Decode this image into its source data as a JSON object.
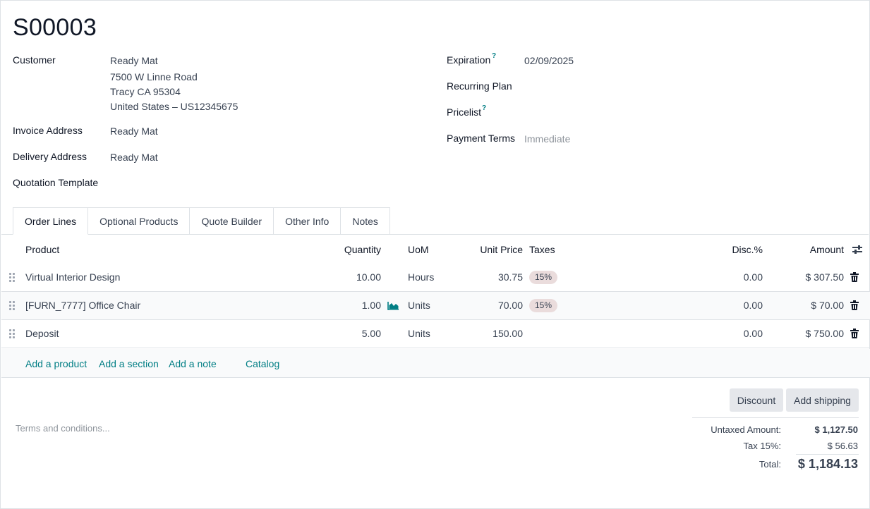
{
  "record": {
    "title": "S00003"
  },
  "left_fields": {
    "customer_label": "Customer",
    "customer_name": "Ready Mat",
    "customer_addr1": "7500 W Linne Road",
    "customer_addr2": "Tracy CA 95304",
    "customer_addr3": "United States – US12345675",
    "invoice_label": "Invoice Address",
    "invoice_value": "Ready Mat",
    "delivery_label": "Delivery Address",
    "delivery_value": "Ready Mat",
    "template_label": "Quotation Template"
  },
  "right_fields": {
    "expiration_label": "Expiration",
    "expiration_help": "?",
    "expiration_value": "02/09/2025",
    "recurring_label": "Recurring Plan",
    "pricelist_label": "Pricelist",
    "pricelist_help": "?",
    "payment_label": "Payment Terms",
    "payment_placeholder": "Immediate"
  },
  "tabs": [
    {
      "label": "Order Lines",
      "active": true
    },
    {
      "label": "Optional Products"
    },
    {
      "label": "Quote Builder"
    },
    {
      "label": "Other Info"
    },
    {
      "label": "Notes"
    }
  ],
  "columns": {
    "product": "Product",
    "quantity": "Quantity",
    "uom": "UoM",
    "unit_price": "Unit Price",
    "taxes": "Taxes",
    "discount": "Disc.%",
    "amount": "Amount"
  },
  "lines": [
    {
      "product": "Virtual Interior Design",
      "quantity": "10.00",
      "uom": "Hours",
      "unit_price": "30.75",
      "tax": "15%",
      "discount": "0.00",
      "amount": "$ 307.50"
    },
    {
      "product": "[FURN_7777] Office Chair",
      "quantity": "1.00",
      "uom": "Units",
      "unit_price": "70.00",
      "tax": "15%",
      "discount": "0.00",
      "amount": "$ 70.00"
    },
    {
      "product": "Deposit",
      "quantity": "5.00",
      "uom": "Units",
      "unit_price": "150.00",
      "tax": "",
      "discount": "0.00",
      "amount": "$ 750.00"
    }
  ],
  "add_links": {
    "add_product": "Add a product",
    "add_section": "Add a section",
    "add_note": "Add a note",
    "catalog": "Catalog"
  },
  "buttons": {
    "discount": "Discount",
    "add_shipping": "Add shipping"
  },
  "terms_placeholder": "Terms and conditions...",
  "totals": {
    "untaxed_label": "Untaxed Amount:",
    "untaxed_value": "$ 1,127.50",
    "tax_label": "Tax 15%:",
    "tax_value": "$ 56.63",
    "total_label": "Total:",
    "total_value": "$ 1,184.13"
  },
  "colors": {
    "accent": "#017e84",
    "badge": "#eadcdc",
    "border": "#dee2e6"
  }
}
